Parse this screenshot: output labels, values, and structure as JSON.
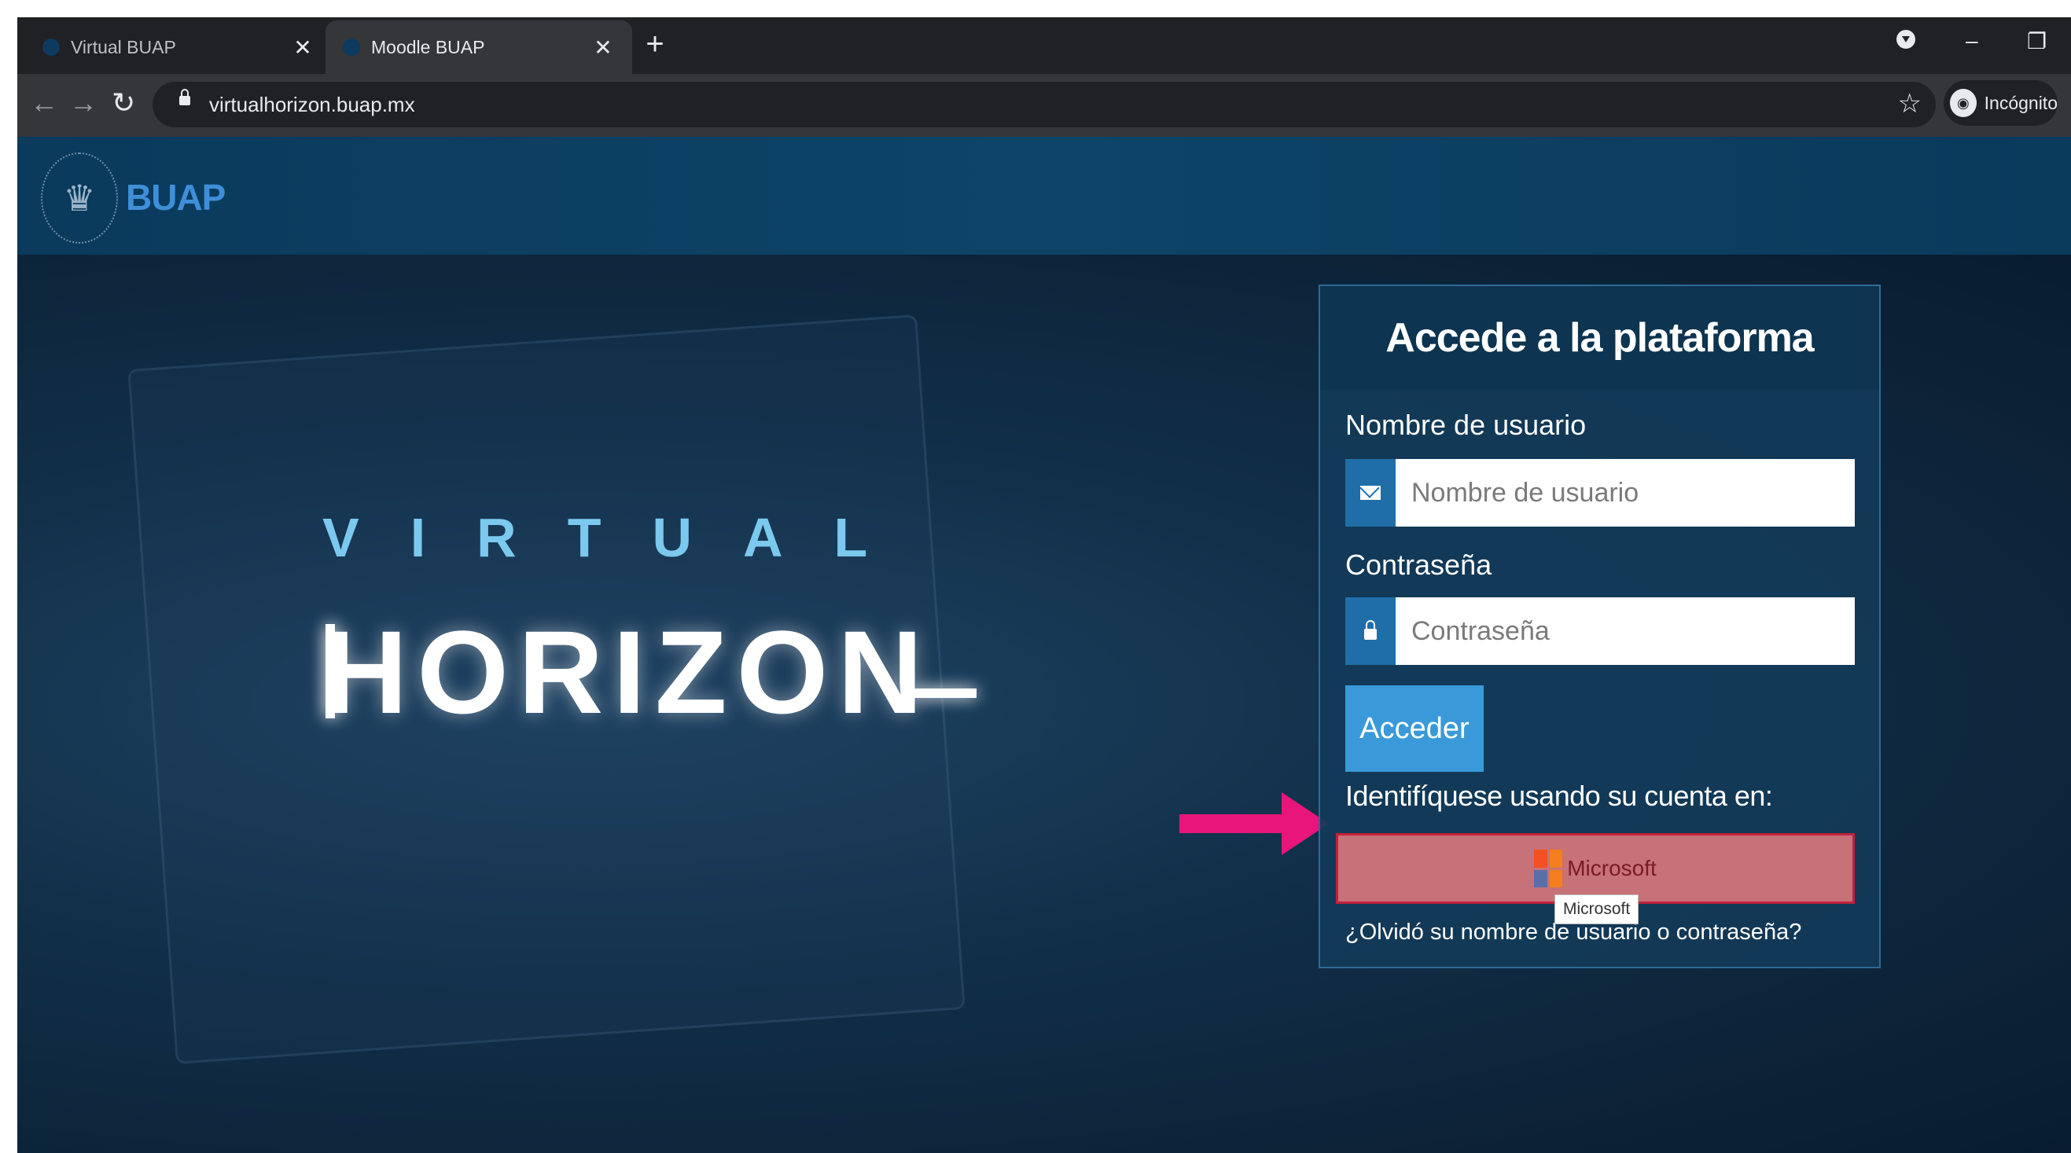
{
  "browser": {
    "tabs": [
      {
        "title": "Virtual BUAP",
        "active": false
      },
      {
        "title": "Moodle BUAP",
        "active": true
      }
    ],
    "new_tab_symbol": "+",
    "close_symbol": "✕",
    "url": "virtualhorizon.buap.mx",
    "profile_label": "Incógnito",
    "window_controls": {
      "minimize": "–",
      "restore": "❐"
    },
    "icons": [
      "back-icon",
      "forward-icon",
      "reload-icon",
      "lock-icon",
      "star-icon",
      "incognito-icon",
      "media-icon"
    ]
  },
  "site": {
    "brand": "BUAP",
    "hero": {
      "line1": "VIRTUAL",
      "line2": "HORIZON"
    }
  },
  "login": {
    "title": "Accede a la plataforma",
    "username_label": "Nombre de usuario",
    "username_placeholder": "Nombre de usuario",
    "password_label": "Contraseña",
    "password_placeholder": "Contraseña",
    "submit_label": "Acceder",
    "identify_label": "Identifíquese usando su cuenta en:",
    "microsoft_label": "Microsoft",
    "tooltip": "Microsoft",
    "forgot_link": "¿Olvidó su nombre de usuario o contraseña?"
  },
  "colors": {
    "header_blue": "#0d4468",
    "button_blue": "#3a9ad9",
    "microsoft_highlight": "#c77178",
    "arrow": "#e8157a",
    "ms_logo": [
      "#f25022",
      "#f27f1b",
      "#5a6fa8",
      "#f27f1b"
    ]
  }
}
